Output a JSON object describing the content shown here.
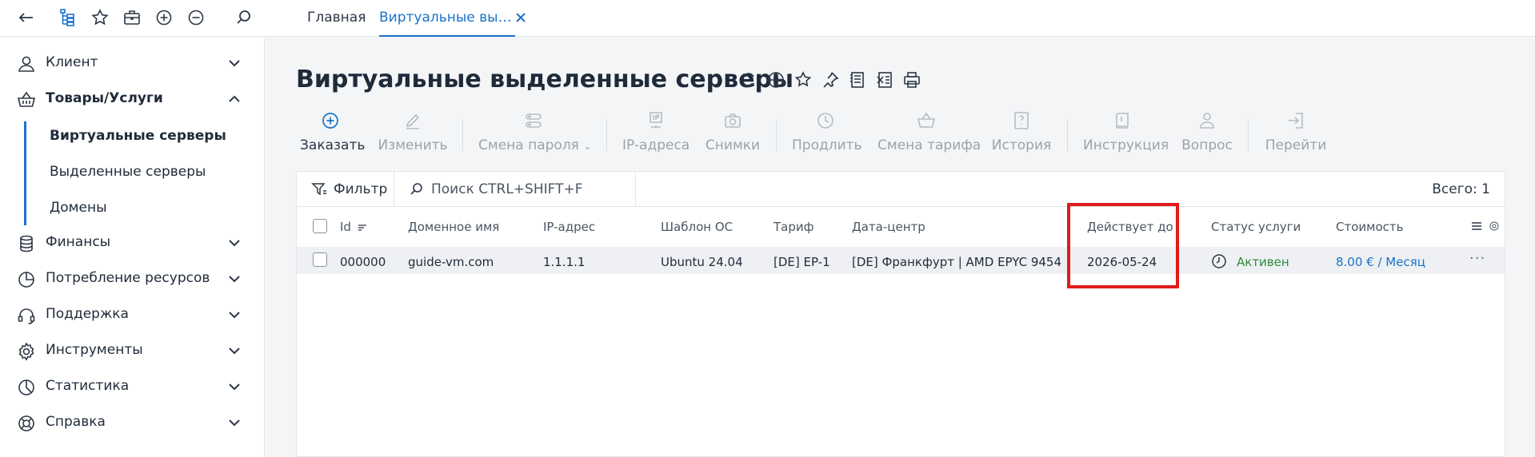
{
  "topbar": {
    "icons": [
      "back-icon",
      "tree-icon",
      "star-icon",
      "briefcase-icon",
      "plus-circle-icon",
      "minus-circle-icon",
      "search-icon"
    ],
    "tabs": [
      {
        "label": "Главная",
        "active": false
      },
      {
        "label": "Виртуальные вы…",
        "active": true
      }
    ]
  },
  "sidebar": {
    "items": [
      {
        "label": "Клиент",
        "icon": "client-icon",
        "expanded": false
      },
      {
        "label": "Товары/Услуги",
        "icon": "basket-icon",
        "expanded": true
      },
      {
        "label": "Финансы",
        "icon": "coins-icon",
        "expanded": false
      },
      {
        "label": "Потребление ресурсов",
        "icon": "pie-chart-icon",
        "expanded": false
      },
      {
        "label": "Поддержка",
        "icon": "headset-icon",
        "expanded": false
      },
      {
        "label": "Инструменты",
        "icon": "gear-icon",
        "expanded": false
      },
      {
        "label": "Статистика",
        "icon": "stats-icon",
        "expanded": false
      },
      {
        "label": "Справка",
        "icon": "lifebuoy-icon",
        "expanded": false
      }
    ],
    "subitems": [
      {
        "label": "Виртуальные серверы",
        "active": true
      },
      {
        "label": "Выделенные серверы",
        "active": false
      },
      {
        "label": "Домены",
        "active": false
      }
    ]
  },
  "page": {
    "title": "Виртуальные выделенные серверы",
    "title_icons": [
      "refresh-icon",
      "globe-icon",
      "star-icon",
      "pin-icon",
      "list-export-icon",
      "excel-icon",
      "print-icon"
    ]
  },
  "toolbar": {
    "order": "Заказать",
    "edit": "Изменить",
    "change_password": "Смена пароля",
    "ip_addresses": "IP-адреса",
    "snapshots": "Снимки",
    "prolong": "Продлить",
    "change_tariff": "Смена тарифа",
    "history": "История",
    "instruction": "Инструкция",
    "question": "Вопрос",
    "go": "Перейти"
  },
  "filter": {
    "button_label": "Фильтр",
    "search_placeholder": "Поиск CTRL+SHIFT+F",
    "total": "Всего: 1"
  },
  "table": {
    "headers": {
      "id": "Id",
      "domain": "Доменное имя",
      "ip": "IP-адрес",
      "os": "Шаблон ОС",
      "tariff": "Тариф",
      "datacenter": "Дата-центр",
      "valid_until": "Действует до",
      "status": "Статус услуги",
      "cost": "Стоимость"
    },
    "rows": [
      {
        "id": "000000",
        "domain": "guide-vm.com",
        "ip": "1.1.1.1",
        "os": "Ubuntu 24.04",
        "tariff": "[DE] EP-1",
        "datacenter": "[DE] Франкфурт | AMD EPYC 9454",
        "valid_until": "2026-05-24",
        "status": "Активен",
        "cost": "8.00 € / Месяц"
      }
    ]
  },
  "colors": {
    "accent": "#1a73c8",
    "status_active": "#2e8b3a",
    "highlight": "#e01b1b",
    "disabled": "#9aa3ad"
  }
}
